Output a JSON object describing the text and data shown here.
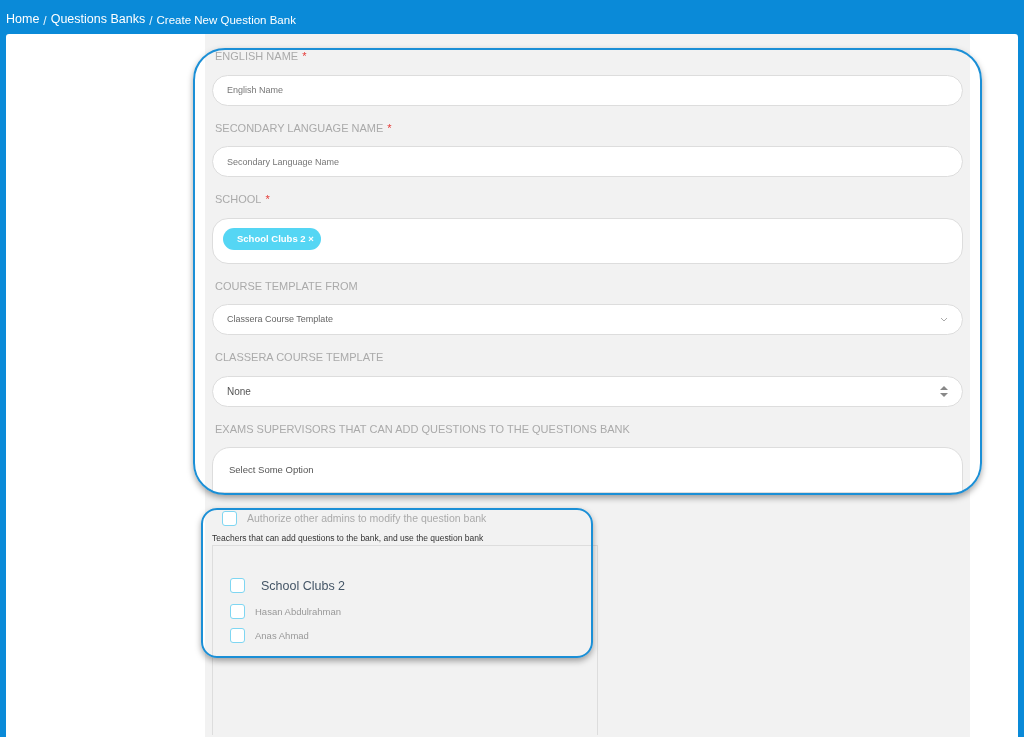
{
  "breadcrumb": [
    {
      "kind": "link",
      "text": "Home"
    },
    {
      "kind": "separator",
      "text": "/"
    },
    {
      "kind": "link",
      "text": "Questions Banks"
    },
    {
      "kind": "separator",
      "text": "/"
    },
    {
      "kind": "current",
      "text": "Create New Question Bank"
    }
  ],
  "fields": [
    {
      "label": "ENGLISH NAME",
      "required_mark": "*",
      "kind": "text",
      "placeholder": "English Name"
    },
    {
      "label": "SECONDARY LANGUAGE NAME",
      "required_mark": "*",
      "kind": "text",
      "placeholder": "Secondary Language Name"
    },
    {
      "label": "SCHOOL",
      "required_mark": "*",
      "kind": "tags",
      "tags": [
        {
          "label": "School Clubs 2",
          "remove": "×"
        }
      ]
    },
    {
      "label": "COURSE TEMPLATE FROM",
      "kind": "dropdown",
      "value": "Classera Course Template"
    },
    {
      "label": "CLASSERA COURSE TEMPLATE",
      "kind": "select",
      "value": "None"
    },
    {
      "label": "EXAMS SUPERVISORS THAT CAN ADD QUESTIONS TO THE QUESTIONS BANK",
      "kind": "multiselect",
      "placeholder": "Select Some Option"
    }
  ],
  "authorize": {
    "label": "Authorize other admins to modify the question bank",
    "checked": false
  },
  "teachers": {
    "label": "Teachers that can add questions to the bank, and use the question bank",
    "groups": [
      {
        "label": "School Clubs 2",
        "checked": false,
        "children": [
          {
            "label": "Hasan Abdulrahman",
            "checked": false
          },
          {
            "label": "Anas Ahmad",
            "checked": false
          }
        ]
      }
    ]
  }
}
